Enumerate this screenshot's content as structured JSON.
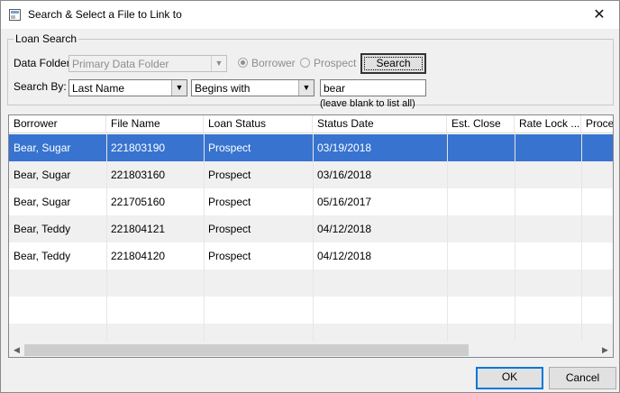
{
  "window": {
    "title": "Search & Select a File to Link to",
    "close_glyph": "✕"
  },
  "loan_search": {
    "legend": "Loan Search",
    "data_folder_label": "Data Folder:",
    "data_folder_value": "Primary Data Folder",
    "borrower_label": "Borrower",
    "prospect_label": "Prospect",
    "search_button": "Search",
    "search_by_label": "Search By:",
    "field_value": "Last Name",
    "operator_value": "Begins with",
    "search_text": "bear",
    "hint": "(leave blank to list all)"
  },
  "grid": {
    "columns": [
      "Borrower",
      "File Name",
      "Loan Status",
      "Status Date",
      "Est. Close",
      "Rate Lock ...",
      "Proce"
    ],
    "rows": [
      [
        "Bear, Sugar",
        "221803190",
        "Prospect",
        "03/19/2018",
        "",
        "",
        ""
      ],
      [
        "Bear, Sugar",
        "221803160",
        "Prospect",
        "03/16/2018",
        "",
        "",
        ""
      ],
      [
        "Bear, Sugar",
        "221705160",
        "Prospect",
        "05/16/2017",
        "",
        "",
        ""
      ],
      [
        "Bear, Teddy",
        "221804121",
        "Prospect",
        "04/12/2018",
        "",
        "",
        ""
      ],
      [
        "Bear, Teddy",
        "221804120",
        "Prospect",
        "04/12/2018",
        "",
        "",
        ""
      ]
    ],
    "selected_row": 0
  },
  "buttons": {
    "ok": "OK",
    "cancel": "Cancel"
  },
  "colors": {
    "selection": "#3873cf"
  }
}
